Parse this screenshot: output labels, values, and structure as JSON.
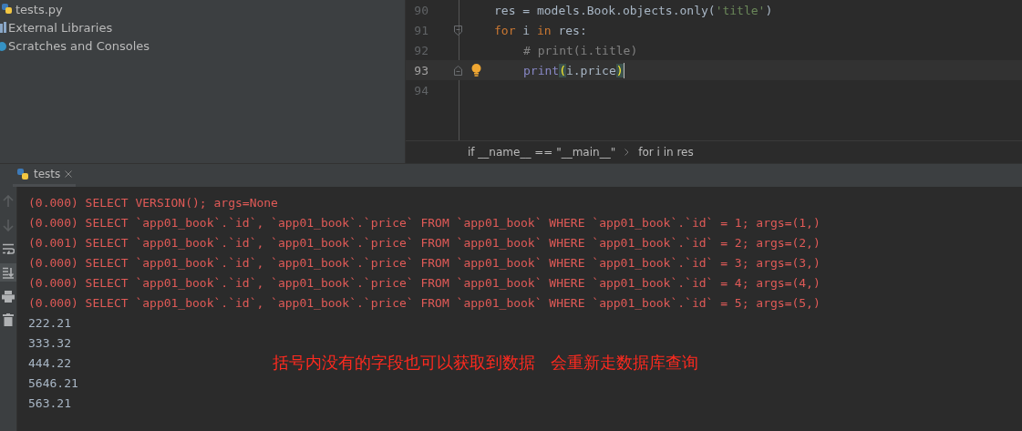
{
  "project_tree": [
    {
      "label": "tests.py",
      "kind": "python-file"
    },
    {
      "label": "External Libraries",
      "kind": "library"
    },
    {
      "label": "Scratches and Consoles",
      "kind": "scratches"
    }
  ],
  "editor": {
    "lines": [
      {
        "number": "90",
        "current": false,
        "bulb": false,
        "fold_open": false,
        "fold_close": false,
        "indented": false,
        "tokens": [
          {
            "text": "res = models.Book.objects.only(",
            "kind": "plain"
          },
          {
            "text": "'title'",
            "kind": "string"
          },
          {
            "text": ")",
            "kind": "plain"
          }
        ]
      },
      {
        "number": "91",
        "current": false,
        "bulb": false,
        "fold_open": true,
        "fold_close": false,
        "indented": false,
        "tokens": [
          {
            "text": "for",
            "kind": "keyword"
          },
          {
            "text": " i ",
            "kind": "plain"
          },
          {
            "text": "in",
            "kind": "keyword"
          },
          {
            "text": " res:",
            "kind": "plain"
          }
        ]
      },
      {
        "number": "92",
        "current": false,
        "bulb": false,
        "fold_open": false,
        "fold_close": false,
        "indented": true,
        "tokens": [
          {
            "text": "# print(i.title)",
            "kind": "comment"
          }
        ]
      },
      {
        "number": "93",
        "current": true,
        "bulb": true,
        "fold_open": false,
        "fold_close": true,
        "indented": true,
        "tokens": [
          {
            "text": "print",
            "kind": "builtin"
          },
          {
            "text": "(",
            "kind": "brace"
          },
          {
            "text": "i.price",
            "kind": "plain"
          },
          {
            "text": ")",
            "kind": "brace"
          }
        ]
      },
      {
        "number": "94",
        "current": false,
        "bulb": false,
        "fold_open": false,
        "fold_close": false
      }
    ],
    "breadcrumbs": [
      "if __name__ == \"__main__\"",
      "for i in res"
    ]
  },
  "run_tabs": [
    {
      "label": "tests",
      "selected": true
    }
  ],
  "console": {
    "tools": [
      {
        "kind": "up",
        "on": false
      },
      {
        "kind": "down",
        "on": false
      },
      {
        "kind": "wrap",
        "on": false
      },
      {
        "kind": "scroll-end",
        "on": true
      },
      {
        "kind": "print",
        "on": false
      },
      {
        "kind": "trash",
        "on": false
      }
    ],
    "lines": [
      {
        "text": "(0.000) SELECT VERSION(); args=None",
        "kind": "stderr"
      },
      {
        "text": "(0.000) SELECT `app01_book`.`id`, `app01_book`.`price` FROM `app01_book` WHERE `app01_book`.`id` = 1; args=(1,)",
        "kind": "stderr"
      },
      {
        "text": "(0.001) SELECT `app01_book`.`id`, `app01_book`.`price` FROM `app01_book` WHERE `app01_book`.`id` = 2; args=(2,)",
        "kind": "stderr"
      },
      {
        "text": "(0.000) SELECT `app01_book`.`id`, `app01_book`.`price` FROM `app01_book` WHERE `app01_book`.`id` = 3; args=(3,)",
        "kind": "stderr"
      },
      {
        "text": "(0.000) SELECT `app01_book`.`id`, `app01_book`.`price` FROM `app01_book` WHERE `app01_book`.`id` = 4; args=(4,)",
        "kind": "stderr"
      },
      {
        "text": "(0.000) SELECT `app01_book`.`id`, `app01_book`.`price` FROM `app01_book` WHERE `app01_book`.`id` = 5; args=(5,)",
        "kind": "stderr"
      },
      {
        "text": "222.21",
        "kind": "stdout"
      },
      {
        "text": "333.32",
        "kind": "stdout"
      },
      {
        "text": "444.22",
        "kind": "stdout"
      },
      {
        "text": "5646.21",
        "kind": "stdout"
      },
      {
        "text": "563.21",
        "kind": "stdout"
      }
    ],
    "annotation": "括号内没有的字段也可以获取到数据   会重新走数据库查询"
  }
}
